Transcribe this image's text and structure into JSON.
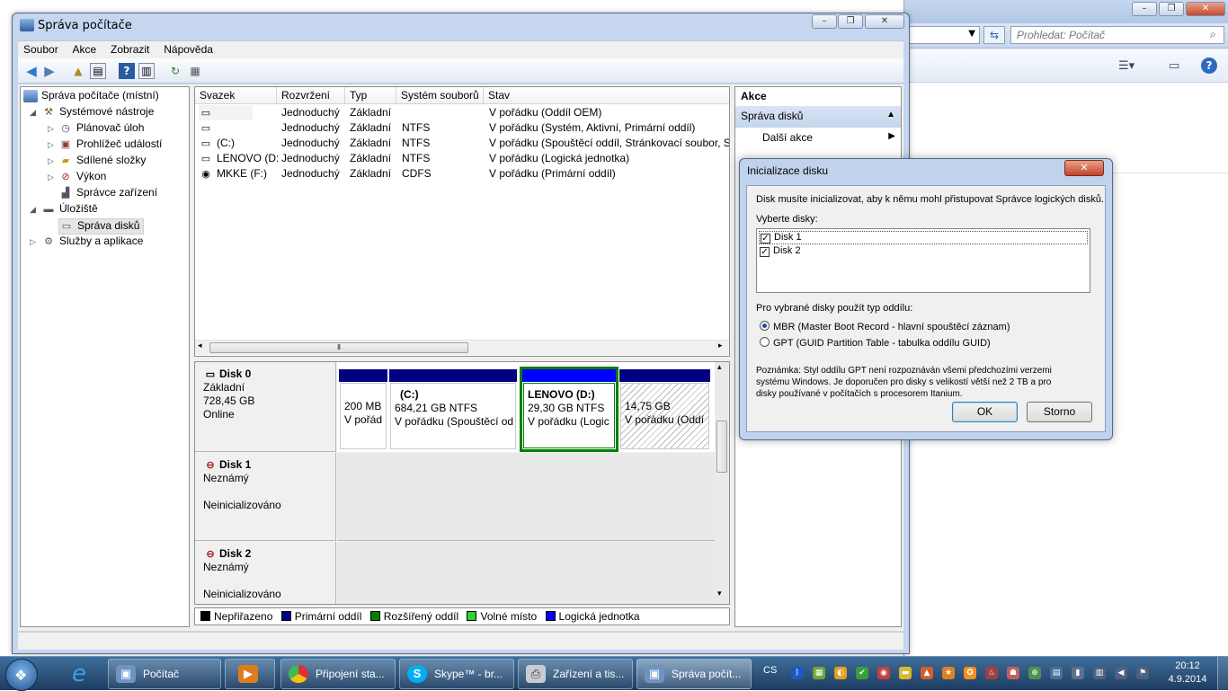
{
  "window": {
    "title": "Správa počítače"
  },
  "menu": [
    "Soubor",
    "Akce",
    "Zobrazit",
    "Nápověda"
  ],
  "tree": [
    {
      "label": "Správa počítače (místní)",
      "level": 0,
      "icon": "computer-management-icon"
    },
    {
      "label": "Systémové nástroje",
      "level": 1,
      "icon": "tools-icon"
    },
    {
      "label": "Plánovač úloh",
      "level": 2,
      "icon": "clock-icon"
    },
    {
      "label": "Prohlížeč událostí",
      "level": 2,
      "icon": "event-viewer-icon"
    },
    {
      "label": "Sdílené složky",
      "level": 2,
      "icon": "shared-folder-icon"
    },
    {
      "label": "Výkon",
      "level": 2,
      "icon": "performance-icon"
    },
    {
      "label": "Správce zařízení",
      "level": 2,
      "icon": "device-manager-icon"
    },
    {
      "label": "Úložiště",
      "level": 1,
      "icon": "storage-icon"
    },
    {
      "label": "Správa disků",
      "level": 2,
      "icon": "disk-management-icon",
      "selected": true
    },
    {
      "label": "Služby a aplikace",
      "level": 1,
      "icon": "services-icon"
    }
  ],
  "volumes": {
    "columns": [
      "Svazek",
      "Rozvržení",
      "Typ",
      "Systém souborů",
      "Stav"
    ],
    "rows": [
      [
        "",
        "Jednoduchý",
        "Základní",
        "",
        "V pořádku (Oddíl OEM)"
      ],
      [
        "",
        "Jednoduchý",
        "Základní",
        "NTFS",
        "V pořádku (Systém, Aktivní, Primární oddíl)"
      ],
      [
        "(C:)",
        "Jednoduchý",
        "Základní",
        "NTFS",
        "V pořádku (Spouštěcí oddíl, Stránkovací soubor, St"
      ],
      [
        "LENOVO (D:)",
        "Jednoduchý",
        "Základní",
        "NTFS",
        "V pořádku (Logická jednotka)"
      ],
      [
        "MKKE (F:)",
        "Jednoduchý",
        "Základní",
        "CDFS",
        "V pořádku (Primární oddíl)"
      ]
    ]
  },
  "disks": {
    "disk0": {
      "name": "Disk 0",
      "type": "Základní",
      "size": "728,45 GB",
      "status": "Online"
    },
    "disk1": {
      "name": "Disk 1",
      "type": "Neznámý",
      "status": "Neinicializováno"
    },
    "disk2": {
      "name": "Disk 2",
      "type": "Neznámý",
      "status": "Neinicializováno"
    },
    "partitions": [
      {
        "label": "",
        "size": "200 MB",
        "status": "V pořád"
      },
      {
        "label": "(C:)",
        "size": "684,21 GB NTFS",
        "status": "V pořádku (Spouštěcí od"
      },
      {
        "label": "LENOVO  (D:)",
        "size": "29,30 GB NTFS",
        "status": "V pořádku (Logic"
      },
      {
        "label": "",
        "size": "14,75 GB",
        "status": "V pořádku (Oddí"
      }
    ]
  },
  "legend": [
    "Nepřiřazeno",
    "Primární oddíl",
    "Rozšířený oddíl",
    "Volné místo",
    "Logická jednotka"
  ],
  "colors": {
    "unallocated": "#000000",
    "primary": "#000080",
    "extended": "#008000",
    "free": "#32d032",
    "logical": "#0000ff"
  },
  "actions": {
    "header": "Akce",
    "section": "Správa disků",
    "more": "Další akce"
  },
  "dialog": {
    "title": "Inicializace disku",
    "intro": "Disk musíte inicializovat, aby k němu mohl přistupovat Správce logických disků.",
    "select_label": "Vyberte disky:",
    "disks": [
      "Disk 1",
      "Disk 2"
    ],
    "style_label": "Pro vybrané disky použít typ oddílu:",
    "mbr": "MBR (Master Boot Record - hlavní spouštěcí záznam)",
    "gpt": "GPT (GUID Partition Table - tabulka oddílu GUID)",
    "note1": "Poznámka: Styl oddílu GPT není rozpoznáván všemi předchozími verzemi",
    "note2": "systému Windows. Je doporučen pro disky s velikostí větší než 2 TB a pro",
    "note3": "disky používané v počítačích s procesorem Itanium.",
    "ok": "OK",
    "cancel": "Storno"
  },
  "background_window": {
    "search_placeholder": "Prohledat: Počítač"
  },
  "taskbar": {
    "items": [
      "Počítač",
      "",
      "Připojení sta...",
      "Skype™ - br...",
      "Zařízení a tis...",
      "Správa počít..."
    ],
    "lang": "CS",
    "time": "20:12",
    "date": "4.9.2014"
  }
}
